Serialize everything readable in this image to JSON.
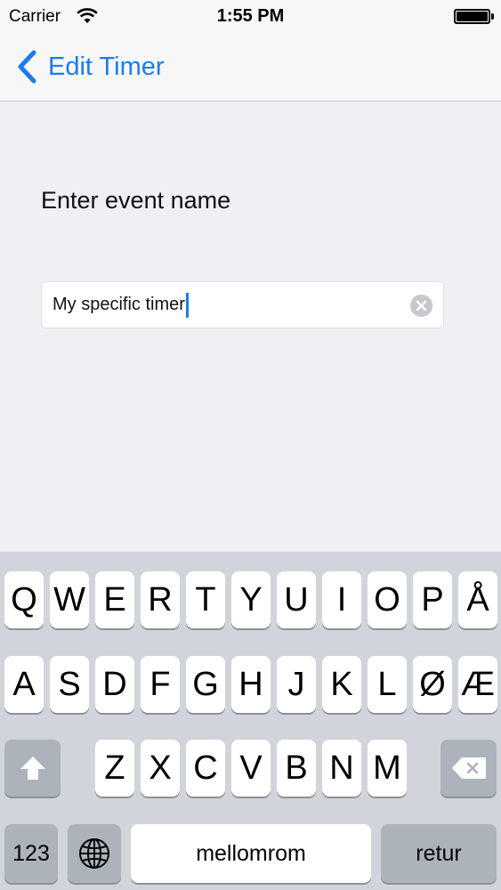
{
  "status_bar": {
    "carrier": "Carrier",
    "time": "1:55 PM",
    "icons": [
      "wifi-icon",
      "battery-icon"
    ]
  },
  "nav": {
    "back_label": "Edit Timer",
    "back_icon": "chevron-left-icon"
  },
  "content": {
    "prompt": "Enter event name",
    "field_value": "My specific timer",
    "clear_icon": "clear-icon"
  },
  "keyboard": {
    "row1": [
      "Q",
      "W",
      "E",
      "R",
      "T",
      "Y",
      "U",
      "I",
      "O",
      "P",
      "Å"
    ],
    "row2": [
      "A",
      "S",
      "D",
      "F",
      "G",
      "H",
      "J",
      "K",
      "L",
      "Ø",
      "Æ"
    ],
    "row3": [
      "Z",
      "X",
      "C",
      "V",
      "B",
      "N",
      "M"
    ],
    "numbers_label": "123",
    "space_label": "mellomrom",
    "return_label": "retur",
    "icons": [
      "shift-icon",
      "delete-icon",
      "globe-icon"
    ]
  },
  "colors": {
    "accent": "#1a7cf0",
    "background": "#efeff4",
    "keyboard_background": "#d1d5db"
  }
}
